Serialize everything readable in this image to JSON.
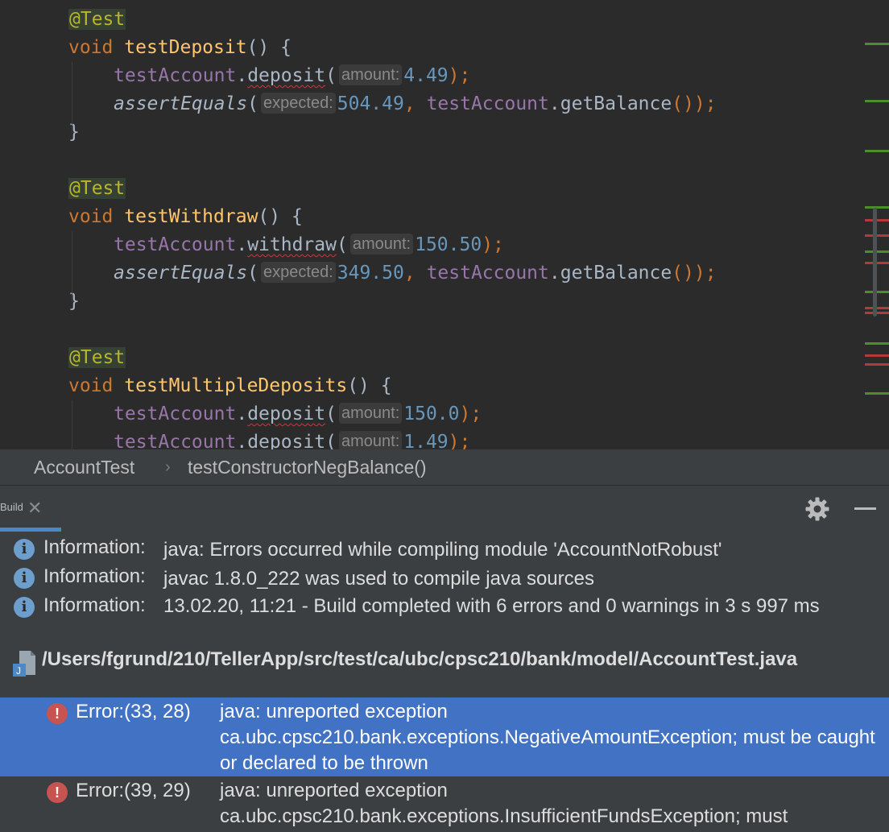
{
  "editor": {
    "lines": [
      {
        "type": "annotation",
        "text": "@Test"
      },
      {
        "type": "method",
        "kw": "void",
        "name": "testDeposit",
        "rest": "() {"
      },
      {
        "type": "call",
        "obj": "testAccount",
        "method": "deposit",
        "hint": "amount:",
        "arg": "4.49",
        "end": ");"
      },
      {
        "type": "assert",
        "fn": "assertEquals",
        "hint": "expected:",
        "arg": "504.49",
        "obj": "testAccount",
        "getter": "getBalance",
        "end": "());"
      },
      {
        "type": "brace",
        "text": "}"
      },
      {
        "type": "blank"
      },
      {
        "type": "annotation",
        "text": "@Test"
      },
      {
        "type": "method",
        "kw": "void",
        "name": "testWithdraw",
        "rest": "() {"
      },
      {
        "type": "call",
        "obj": "testAccount",
        "method": "withdraw",
        "hint": "amount:",
        "arg": "150.50",
        "end": ");"
      },
      {
        "type": "assert",
        "fn": "assertEquals",
        "hint": "expected:",
        "arg": "349.50",
        "obj": "testAccount",
        "getter": "getBalance",
        "end": "());"
      },
      {
        "type": "brace",
        "text": "}"
      },
      {
        "type": "blank"
      },
      {
        "type": "annotation",
        "text": "@Test"
      },
      {
        "type": "method",
        "kw": "void",
        "name": "testMultipleDeposits",
        "rest": "() {"
      },
      {
        "type": "call",
        "obj": "testAccount",
        "method": "deposit",
        "hint": "amount:",
        "arg": "150.0",
        "end": ");"
      },
      {
        "type": "call",
        "obj": "testAccount",
        "method": "deposit",
        "hint": "amount:",
        "arg": "1.49",
        "end": ");"
      }
    ],
    "error_indicator": "!"
  },
  "breadcrumb": {
    "items": [
      "AccountTest",
      "testConstructorNegBalance()"
    ],
    "separator": "›"
  },
  "build": {
    "tab_label": "Build",
    "close_glyph": "✕",
    "info_glyph": "i",
    "error_glyph": "!",
    "messages": [
      {
        "label": "Information:",
        "text": "java: Errors occurred while compiling module 'AccountNotRobust'"
      },
      {
        "label": "Information:",
        "text": "javac 1.8.0_222 was used to compile java sources"
      },
      {
        "label": "Information:",
        "text": "13.02.20, 11:21 - Build completed with 6 errors and 0 warnings in 3 s 997 ms"
      }
    ],
    "file_path": "/Users/fgrund/210/TellerApp/src/test/ca/ubc/cpsc210/bank/model/AccountTest.java",
    "errors": [
      {
        "label": "Error:(33, 28)",
        "text": "java: unreported exception ca.ubc.cpsc210.bank.exceptions.NegativeAmountException; must be caught or declared to be thrown",
        "selected": true
      },
      {
        "label": "Error:(39, 29)",
        "text": "java: unreported exception ca.ubc.cpsc210.bank.exceptions.InsufficientFundsException; must",
        "selected": false
      }
    ]
  },
  "colors": {
    "editor_bg": "#2b2b2b",
    "panel_bg": "#3c3f41",
    "selection": "#4272c4",
    "annotation": "#bbb529",
    "keyword": "#cc7832",
    "method": "#ffc66d",
    "field": "#9876aa",
    "number": "#6897bb",
    "text": "#a9b7c6",
    "error": "#c75450",
    "info": "#6d9fce",
    "ok_mark": "#4b8f2c"
  }
}
